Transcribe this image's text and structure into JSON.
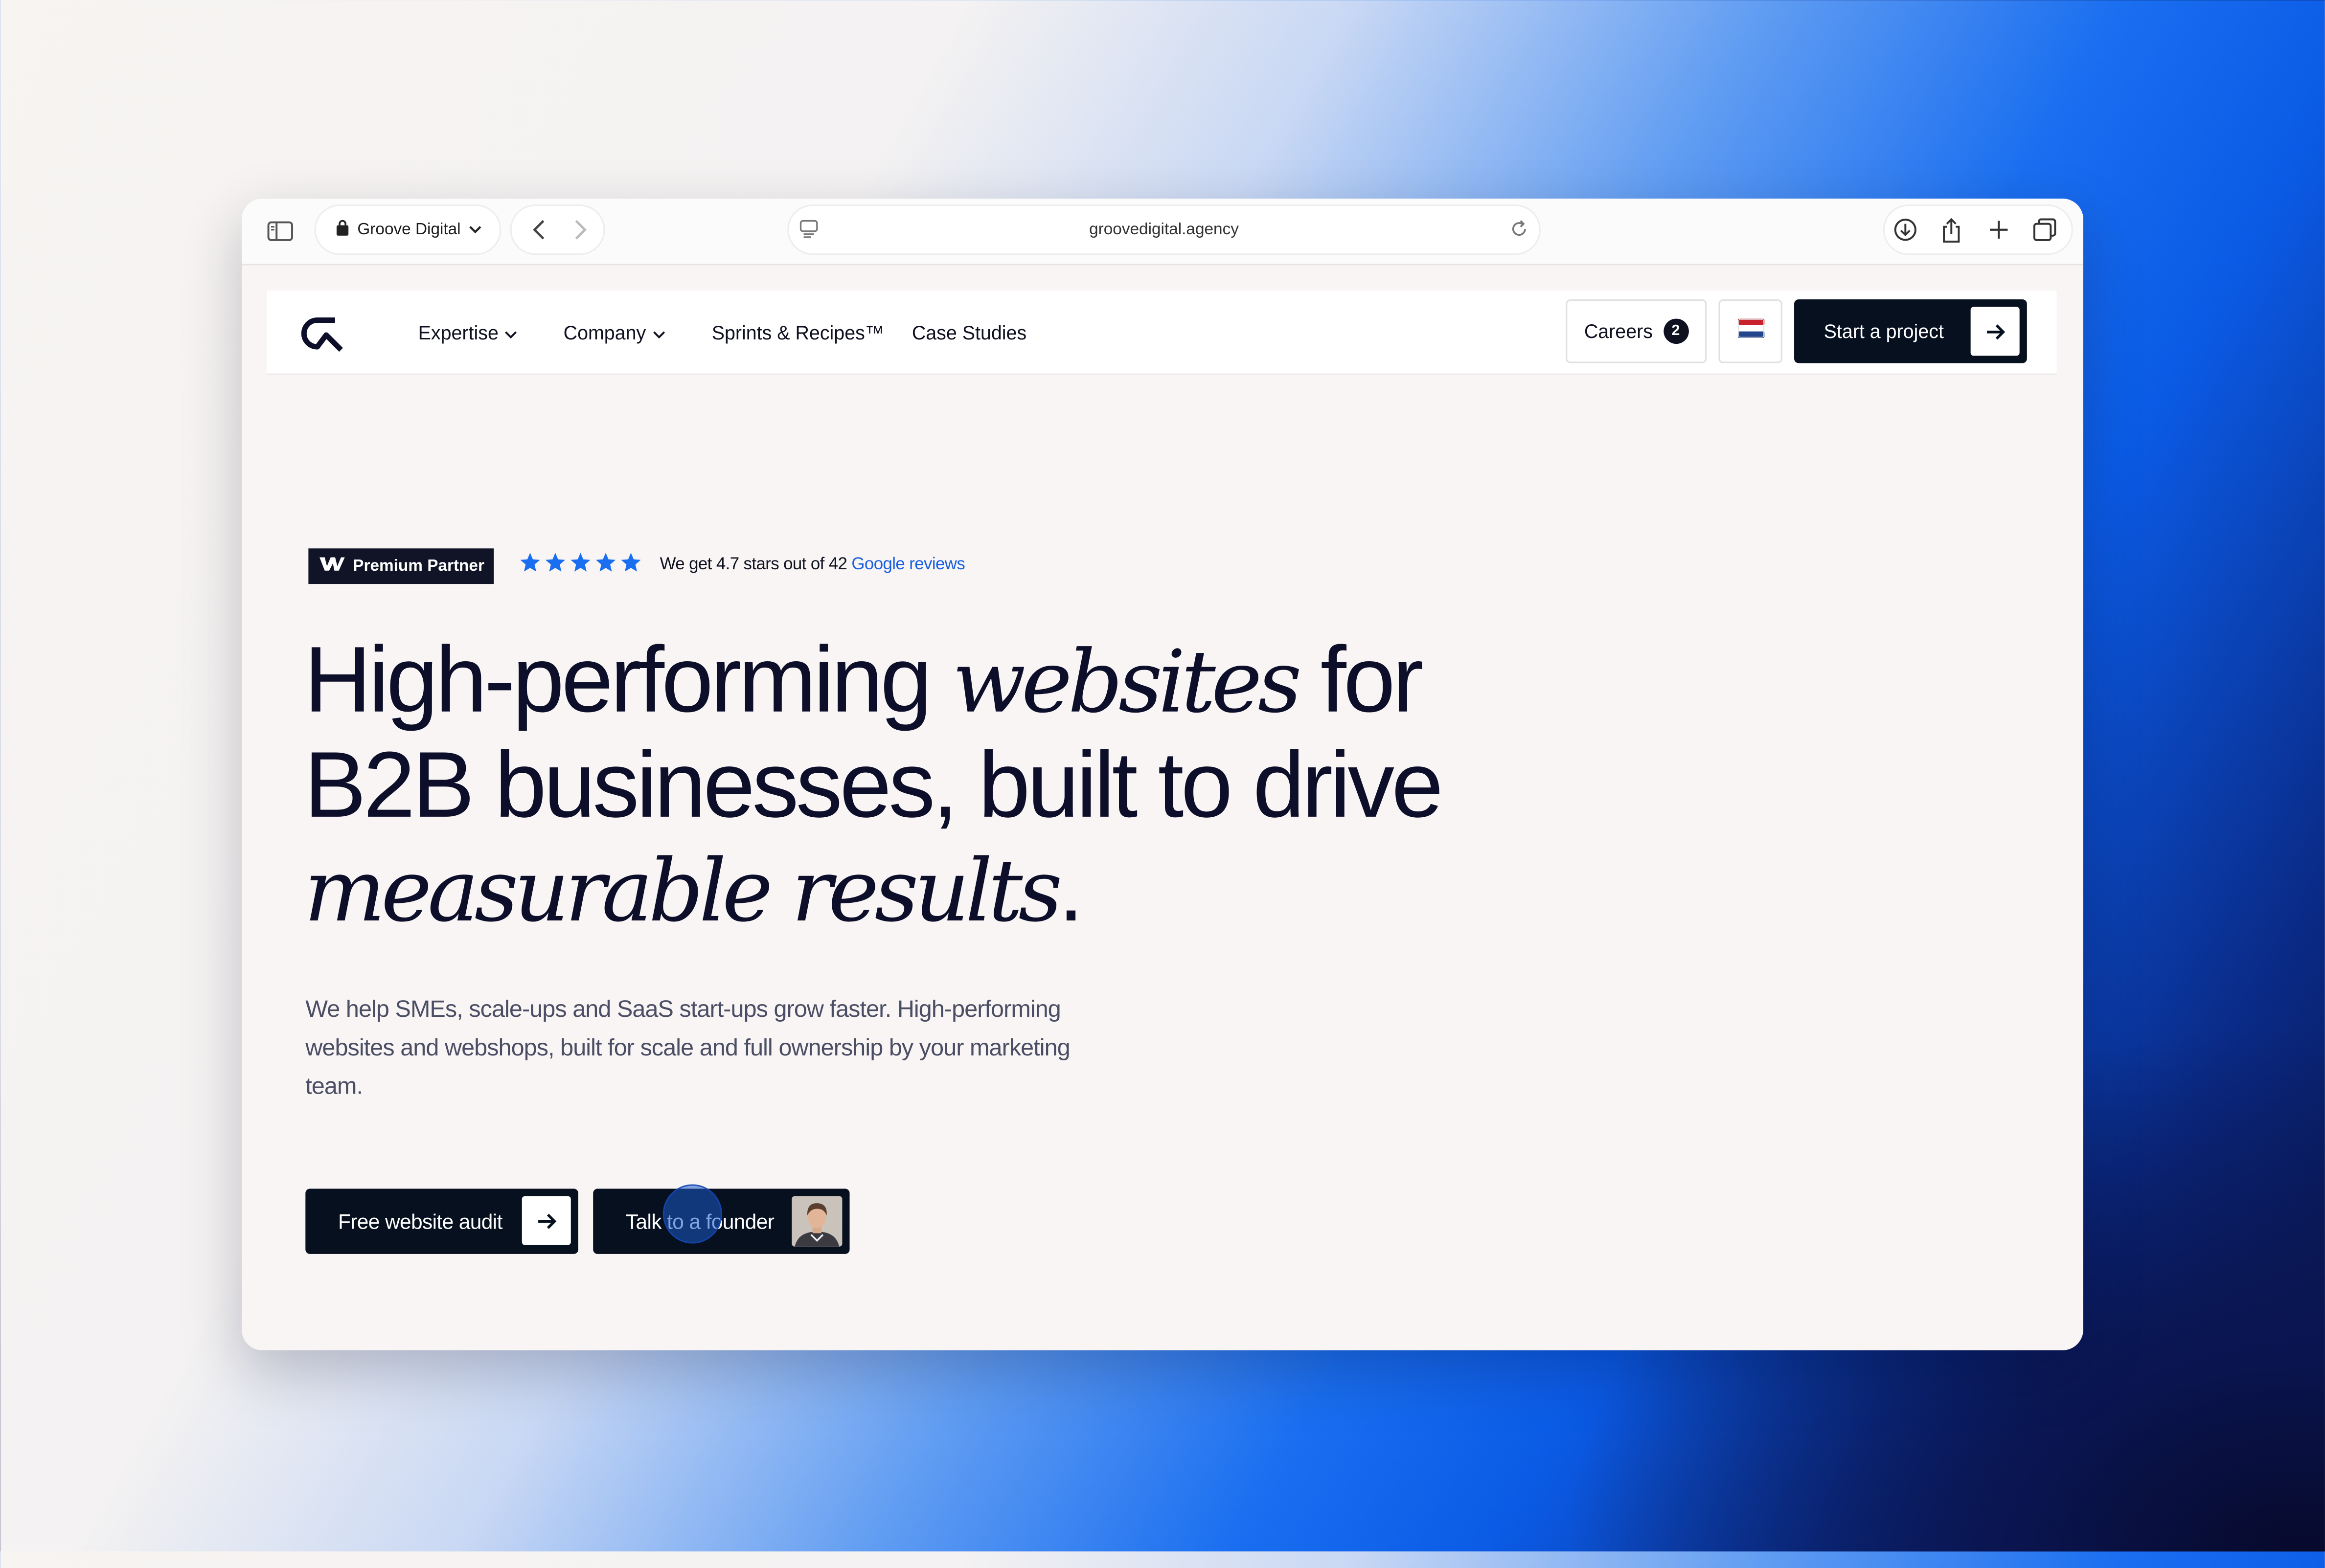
{
  "browser": {
    "tab_title": "Groove Digital",
    "url": "groovedigital.agency"
  },
  "nav": {
    "items": [
      {
        "label": "Expertise"
      },
      {
        "label": "Company"
      },
      {
        "label": "Sprints & Recipes™"
      },
      {
        "label": "Case Studies"
      }
    ],
    "careers_label": "Careers",
    "careers_count": "2",
    "cta_label": "Start a project"
  },
  "hero": {
    "partner_badge": "Premium Partner",
    "rating_stars": 5,
    "rating_text": "We get 4.7 stars out of 42",
    "rating_link": "Google reviews",
    "headline": {
      "part1": "High-performing ",
      "italic1": "websites",
      "part2": " for B2B businesses, built to drive ",
      "italic2": "measurable results",
      "part3": "."
    },
    "subtext": "We help SMEs, scale-ups and SaaS start-ups grow faster. High-performing websites and webshops, built for scale and full ownership by your marketing team.",
    "primary_cta": "Free website audit",
    "secondary_cta": "Talk to a founder"
  },
  "colors": {
    "brand_dark": "#07101f",
    "star_blue": "#1a6ef0",
    "link_blue": "#1a5fe0"
  },
  "icons": [
    "sidebar-icon",
    "lock-icon",
    "chevron-down-icon",
    "back-icon",
    "forward-icon",
    "reader-icon",
    "reload-icon",
    "download-icon",
    "share-icon",
    "plus-icon",
    "tabs-icon",
    "logo-icon",
    "star-icon",
    "flag-nl-icon",
    "arrow-right-icon",
    "webflow-icon"
  ]
}
